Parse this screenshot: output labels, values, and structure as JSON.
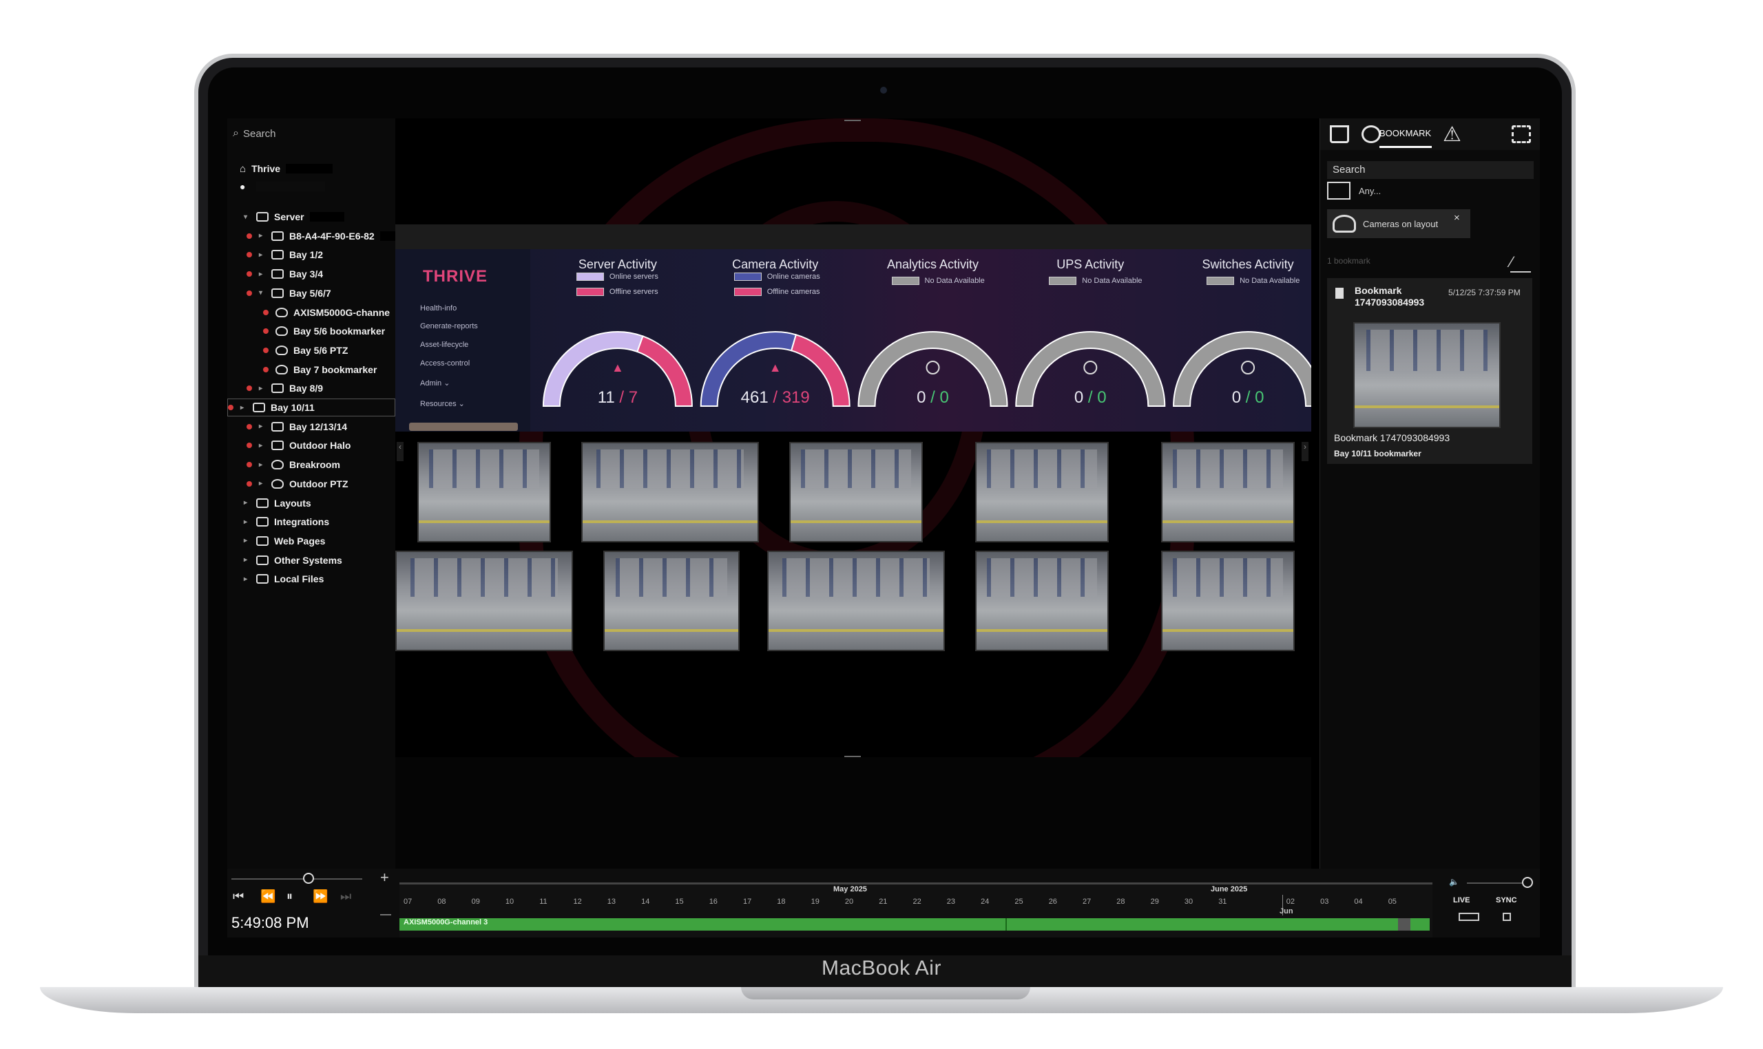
{
  "device": {
    "brand_label": "MacBook Air"
  },
  "left_panel": {
    "search_placeholder": "Search",
    "site_name": "Thrive",
    "tree": [
      {
        "label": "Server",
        "level": 0,
        "icon": "server-icon"
      },
      {
        "label": "B8-A4-4F-90-E6-82",
        "level": 1,
        "icon": "server-icon",
        "dot": true
      },
      {
        "label": "Bay 1/2",
        "level": 1,
        "icon": "server-icon",
        "dot": true
      },
      {
        "label": "Bay 3/4",
        "level": 1,
        "icon": "server-icon",
        "dot": true
      },
      {
        "label": "Bay 5/6/7",
        "level": 1,
        "icon": "server-icon",
        "dot": true
      },
      {
        "label": "AXISM5000G-channe",
        "level": 2,
        "icon": "camera-icon",
        "dot": true
      },
      {
        "label": "Bay 5/6 bookmarker",
        "level": 2,
        "icon": "camera-icon",
        "dot": true
      },
      {
        "label": "Bay 5/6 PTZ",
        "level": 2,
        "icon": "camera-icon",
        "dot": true
      },
      {
        "label": "Bay 7 bookmarker",
        "level": 2,
        "icon": "camera-icon",
        "dot": true
      },
      {
        "label": "Bay 8/9",
        "level": 1,
        "icon": "server-icon",
        "dot": true
      },
      {
        "label": "Bay 10/11",
        "level": 1,
        "icon": "server-icon",
        "dot": true
      },
      {
        "label": "Bay 12/13/14",
        "level": 1,
        "icon": "server-icon",
        "dot": true
      },
      {
        "label": "Outdoor Halo",
        "level": 1,
        "icon": "server-icon",
        "dot": true
      },
      {
        "label": "Breakroom",
        "level": 1,
        "icon": "camera-icon",
        "dot": true
      },
      {
        "label": "Outdoor PTZ",
        "level": 1,
        "icon": "camera-icon",
        "dot": true
      },
      {
        "label": "Layouts",
        "level": 0,
        "icon": "layouts-icon"
      },
      {
        "label": "Integrations",
        "level": 0,
        "icon": "integrations-icon"
      },
      {
        "label": "Web Pages",
        "level": 0,
        "icon": "globe-icon"
      },
      {
        "label": "Other Systems",
        "level": 0,
        "icon": "other-systems-icon"
      },
      {
        "label": "Local Files",
        "level": 0,
        "icon": "folder-icon"
      }
    ]
  },
  "dashboard": {
    "logo": "THRIVE",
    "menu": [
      "Health-info",
      "Generate-reports",
      "Asset-lifecycle",
      "Access-control",
      "Admin",
      "Resources"
    ],
    "gauges": [
      {
        "title": "Server Activity",
        "legend": [
          "Online servers",
          "Offline servers"
        ],
        "online": "11",
        "offline": "7",
        "online_fraction": 0.61
      },
      {
        "title": "Camera Activity",
        "legend": [
          "Online cameras",
          "Offline cameras"
        ],
        "online": "461",
        "offline": "319",
        "online_fraction": 0.59
      },
      {
        "title": "Analytics Activity",
        "legend": [
          "No Data Available"
        ],
        "online": "0",
        "offline": "0"
      },
      {
        "title": "UPS Activity",
        "legend": [
          "No Data Available"
        ],
        "online": "0",
        "offline": "0"
      },
      {
        "title": "Switches Activity",
        "legend": [
          "No Data Available"
        ],
        "online": "0",
        "offline": "0"
      }
    ],
    "colors": {
      "online_server": "#c9b8ee",
      "offline": "#e0457a",
      "online_camera": "#4c55a8",
      "nodata": "#9a9a9a"
    }
  },
  "right_panel": {
    "tab_label": "BOOKMARK",
    "search_placeholder": "Search",
    "filter_any": "Any...",
    "filter_chip": "Cameras on layout",
    "count": "1 bookmark",
    "bookmark": {
      "title": "Bookmark 1747093084993",
      "timestamp": "5/12/25 7:37:59 PM",
      "caption": "Bookmark 1747093084993",
      "camera": "Bay 10/11 bookmarker"
    }
  },
  "timeline": {
    "current_time": "5:49:08 PM",
    "month_1": "May 2025",
    "month_2": "June 2025",
    "jun_label": "Jun",
    "days": [
      "07",
      "08",
      "09",
      "10",
      "11",
      "12",
      "13",
      "14",
      "15",
      "16",
      "17",
      "18",
      "19",
      "20",
      "21",
      "22",
      "23",
      "24",
      "25",
      "26",
      "27",
      "28",
      "29",
      "30",
      "31",
      "",
      "02",
      "03",
      "04",
      "05"
    ],
    "track_label": "AXISM5000G-channel 3",
    "live_label": "LIVE",
    "sync_label": "SYNC",
    "plus": "+",
    "minus": "—"
  }
}
